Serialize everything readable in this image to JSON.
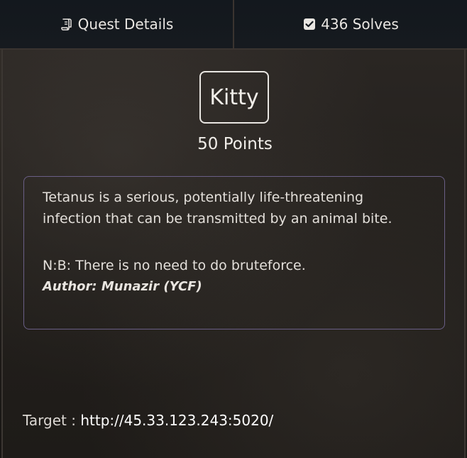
{
  "tabs": [
    {
      "label": "Quest Details",
      "icon": "scroll-icon"
    },
    {
      "label": "436 Solves",
      "icon": "checkbox-icon"
    }
  ],
  "challenge": {
    "name": "Kitty",
    "points": "50 Points",
    "description_line1": "Tetanus is a serious, potentially life-threatening",
    "description_line2": "infection that can be transmitted by an animal bite.",
    "note": "N:B: There is no need to do bruteforce.",
    "author": "Author: Munazir (YCF)",
    "target_label": "Target : ",
    "target_url": "http://45.33.123.243:5020/"
  },
  "colors": {
    "accent_border": "#6a5f86",
    "text": "#e9e6e2",
    "tab_bg": "#13181e"
  }
}
